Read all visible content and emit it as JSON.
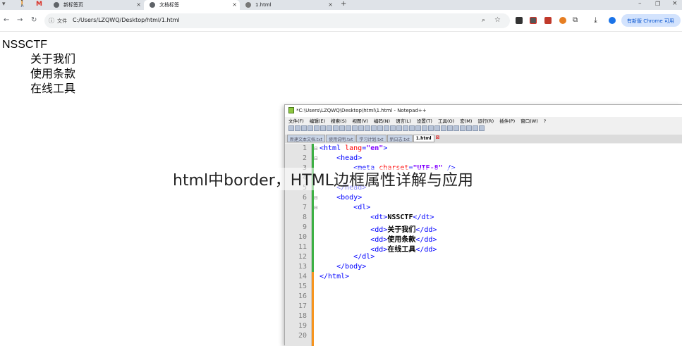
{
  "tabs": [
    {
      "label": "新标签页",
      "icon": "chrome-logo-icon"
    },
    {
      "label": "文档标签",
      "icon": "chrome-logo-icon",
      "active": true
    },
    {
      "label": "1.html",
      "icon": "globe-icon"
    }
  ],
  "address": {
    "label": "文件",
    "url": "C:/Users/LZQWQ/Desktop/html/1.html"
  },
  "update_button": "有新版 Chrome 可用",
  "page": {
    "dt": "NSSCTF",
    "dd": [
      "关于我们",
      "使用条款",
      "在线工具"
    ]
  },
  "notepad": {
    "title": "*C:\\Users\\LZQWQ\\Desktop\\html\\1.html - Notepad++",
    "menu": [
      "文件(F)",
      "编辑(E)",
      "搜索(S)",
      "视图(V)",
      "编码(N)",
      "语言(L)",
      "设置(T)",
      "工具(O)",
      "宏(M)",
      "运行(R)",
      "插件(P)",
      "窗口(W)",
      "?"
    ],
    "file_tabs": [
      "新建文本文档.txt",
      "使用说明.txt",
      "学习计划.txt",
      "新日志.txt",
      "1.html"
    ],
    "lines": [
      "1",
      "2",
      "3",
      "4",
      "5",
      "6",
      "7",
      "8",
      "9",
      "10",
      "11",
      "12",
      "13",
      "14",
      "15",
      "16",
      "17",
      "18",
      "19",
      "20"
    ]
  },
  "watermark": "html中border，HTML边框属性详解与应用"
}
